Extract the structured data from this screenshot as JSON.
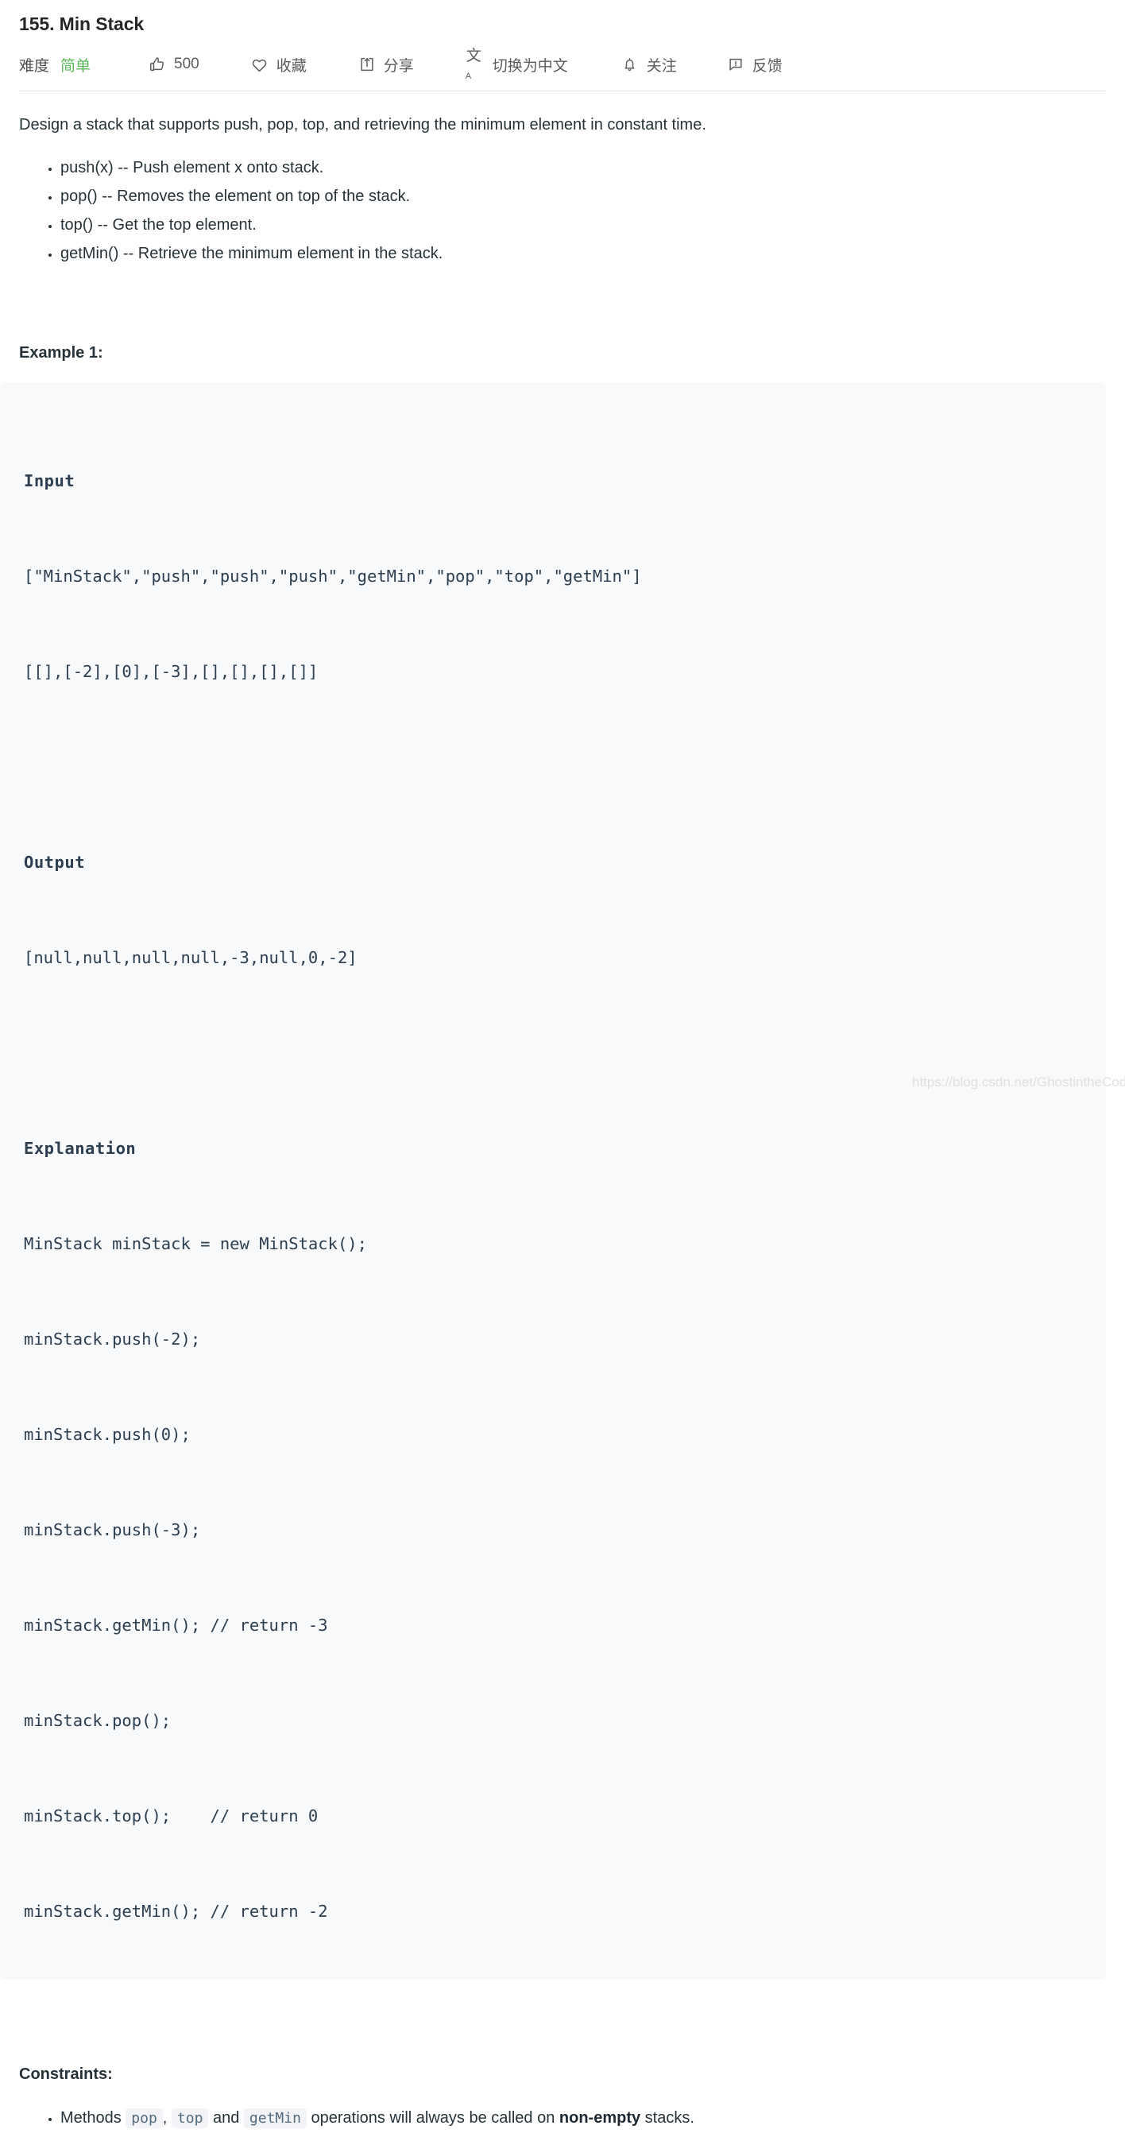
{
  "header": {
    "title": "155. Min Stack",
    "difficulty_label": "难度",
    "difficulty_value": "简单",
    "difficulty_color": "#5cb85c",
    "likes_count": "500",
    "favorite_label": "收藏",
    "share_label": "分享",
    "translate_label": "切换为中文",
    "follow_label": "关注",
    "feedback_label": "反馈",
    "icons": {
      "thumbs_up": "thumbs-up-icon",
      "heart": "heart-icon",
      "share": "share-icon",
      "translate": "translate-icon",
      "bell": "bell-icon",
      "feedback": "feedback-icon"
    }
  },
  "description": {
    "intro": "Design a stack that supports push, pop, top, and retrieving the minimum element in constant time.",
    "methods": [
      "push(x) -- Push element x onto stack.",
      "pop() -- Removes the element on top of the stack.",
      "top() -- Get the top element.",
      "getMin() -- Retrieve the minimum element in the stack."
    ]
  },
  "example": {
    "heading": "Example 1:",
    "input_label": "Input",
    "input_lines": [
      "[\"MinStack\",\"push\",\"push\",\"push\",\"getMin\",\"pop\",\"top\",\"getMin\"]",
      "[[],[-2],[0],[-3],[],[],[],[]]"
    ],
    "output_label": "Output",
    "output_lines": [
      "[null,null,null,null,-3,null,0,-2]"
    ],
    "explanation_label": "Explanation",
    "explanation_lines": [
      "MinStack minStack = new MinStack();",
      "minStack.push(-2);",
      "minStack.push(0);",
      "minStack.push(-3);",
      "minStack.getMin(); // return -3",
      "minStack.pop();",
      "minStack.top();    // return 0",
      "minStack.getMin(); // return -2"
    ]
  },
  "constraints": {
    "heading": "Constraints:",
    "item": {
      "prefix": "Methods ",
      "code_pop": "pop",
      "separator_comma": ",",
      "code_top": "top",
      "separator_and": " and ",
      "code_getmin": "getMin",
      "middle": " operations will always be called on ",
      "bold": "non-empty",
      "suffix": " stacks."
    }
  },
  "watermark": "https://blog.csdn.net/GhostintheCode"
}
